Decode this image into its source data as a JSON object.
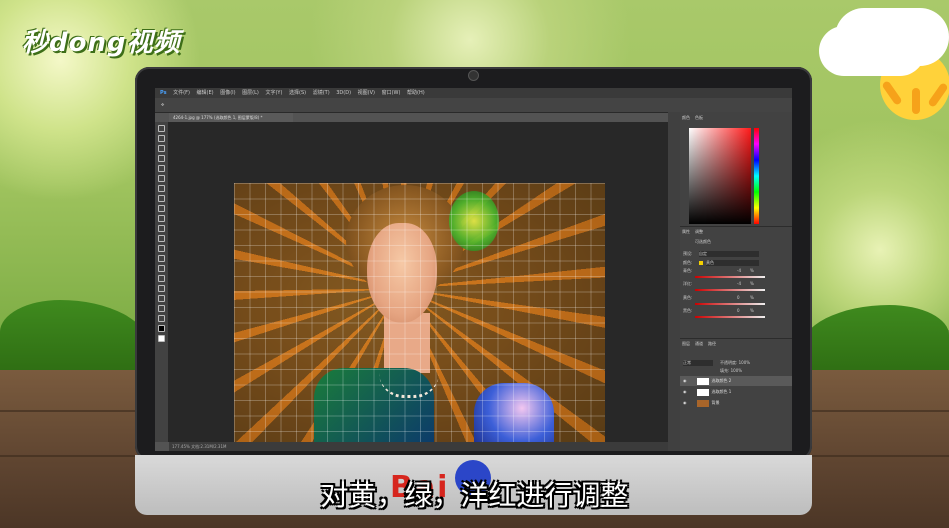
{
  "logo": {
    "text": "秒dong视频"
  },
  "subtitle": "对黄，绿，洋红进行调整",
  "watermark": "Bai",
  "photoshop": {
    "menu": [
      "文件(F)",
      "编辑(E)",
      "图像(I)",
      "图层(L)",
      "文字(Y)",
      "选择(S)",
      "滤镜(T)",
      "3D(D)",
      "视图(V)",
      "窗口(W)",
      "帮助(H)"
    ],
    "document_tab": "4264-1.jpg @ 177% (选取颜色 1, 图层蒙版/8) *",
    "status_bar": "177.45%    文档:2.31M/2.31M",
    "panels": {
      "color_tabs": [
        "颜色",
        "色板"
      ],
      "properties_tabs": [
        "属性",
        "调整"
      ],
      "properties_title": "可选颜色",
      "preset_label": "预设:",
      "preset_value": "自定",
      "colors_label": "颜色:",
      "colors_value": "黄色",
      "sliders": [
        {
          "label": "青色:",
          "value": "-4",
          "unit": "%"
        },
        {
          "label": "洋红:",
          "value": "-4",
          "unit": "%"
        },
        {
          "label": "黄色:",
          "value": "0",
          "unit": "%"
        },
        {
          "label": "黑色:",
          "value": "0",
          "unit": "%"
        }
      ],
      "layers_tabs": [
        "图层",
        "通道",
        "路径"
      ],
      "blend_mode": "正常",
      "opacity": "不透明度: 100%",
      "fill": "填充: 100%",
      "layers": [
        {
          "name": "选取颜色 2"
        },
        {
          "name": "选取颜色 1"
        },
        {
          "name": "背景"
        }
      ]
    }
  }
}
